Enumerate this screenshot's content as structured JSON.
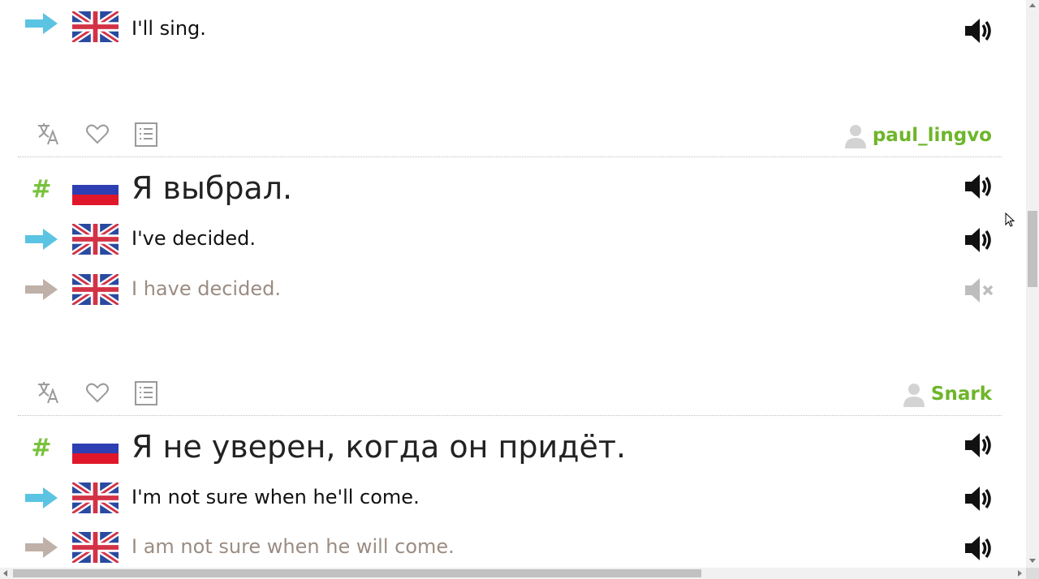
{
  "sentences": [
    {
      "kind": "direct",
      "text": "I'll sing.",
      "lang": "en",
      "audio": "available"
    },
    {
      "kind": "main",
      "text": "Я выбрал.",
      "lang": "ru",
      "audio": "available"
    },
    {
      "kind": "direct",
      "text": "I've decided.",
      "lang": "en",
      "audio": "available"
    },
    {
      "kind": "indirect",
      "text": "I have decided.",
      "lang": "en",
      "audio": "unavailable"
    },
    {
      "kind": "main",
      "text": "Я не уверен, когда он придёт.",
      "lang": "ru",
      "audio": "available"
    },
    {
      "kind": "direct",
      "text": "I'm not sure when he'll come.",
      "lang": "en",
      "audio": "available"
    },
    {
      "kind": "indirect",
      "text": "I am not sure when he will come.",
      "lang": "en",
      "audio": "available"
    }
  ],
  "toolbars": [
    {
      "owner": "paul_lingvo"
    },
    {
      "owner": "Snark"
    }
  ],
  "labels": {
    "hash": "#"
  },
  "icons": {
    "translate": "translate-icon",
    "favorite": "heart-icon",
    "lists": "list-icon",
    "owner": "user-icon",
    "audio": "speaker-icon",
    "no_audio": "speaker-muted-icon",
    "direct_arrow": "arrow-right-blue-icon",
    "indirect_arrow": "arrow-right-gray-icon"
  },
  "colors": {
    "direct_arrow": "#5bc4e2",
    "indirect_arrow": "#bfb1a8",
    "hash": "#78c23c",
    "owner_name": "#6eb52a",
    "indirect_text": "#9b8c82",
    "icon_gray": "#9a9a9a"
  }
}
